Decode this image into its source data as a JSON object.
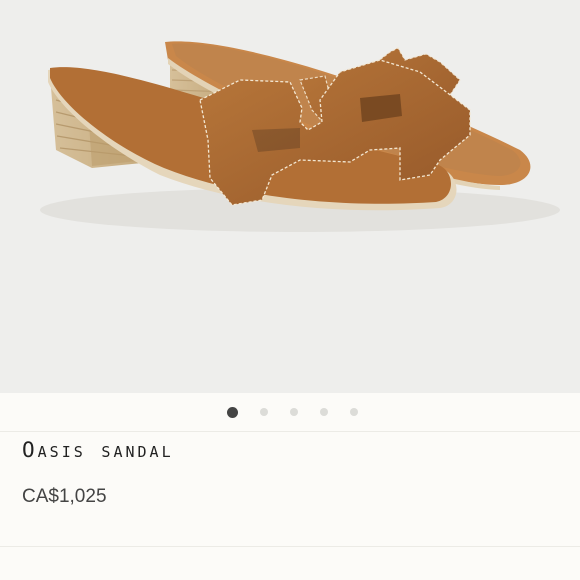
{
  "product": {
    "image_alt_icon": "sandal-product-image",
    "name": "Oasis sandal",
    "price": "CA$1,025"
  },
  "carousel": {
    "page_count": 5,
    "active_index": 0
  },
  "colors": {
    "background": "#fcfbf8",
    "image_background": "#eeeeec",
    "leather": "#a8682f",
    "dot_active": "#444444",
    "dot_inactive": "#dcdcd8"
  }
}
